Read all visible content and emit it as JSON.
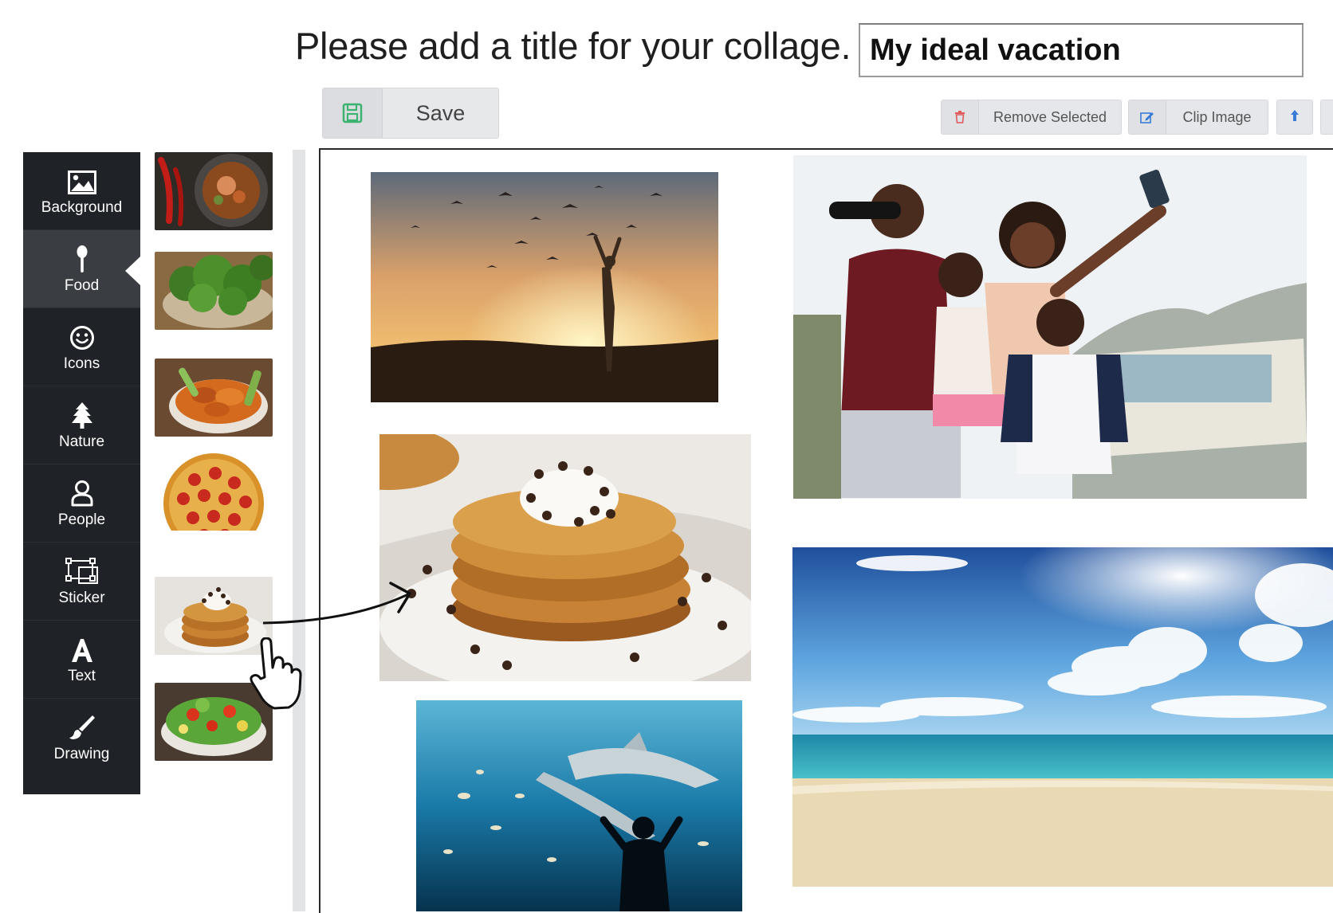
{
  "title_row": {
    "prompt": "Please add a title for your collage.",
    "title_value": "My ideal vacation"
  },
  "toolbar": {
    "save_label": "Save",
    "remove_selected_label": "Remove Selected",
    "clip_image_label": "Clip Image",
    "save_icon": "floppy-disk-icon",
    "remove_icon": "trash-icon",
    "clip_icon": "edit-icon",
    "up_icon": "arrow-up-icon"
  },
  "sidebar": {
    "items": [
      {
        "label": "Background",
        "icon": "image-icon"
      },
      {
        "label": "Food",
        "icon": "spoon-icon"
      },
      {
        "label": "Icons",
        "icon": "smiley-icon"
      },
      {
        "label": "Nature",
        "icon": "tree-icon"
      },
      {
        "label": "People",
        "icon": "person-icon"
      },
      {
        "label": "Sticker",
        "icon": "transform-icon"
      },
      {
        "label": "Text",
        "icon": "letter-a-icon"
      },
      {
        "label": "Drawing",
        "icon": "brush-icon"
      }
    ],
    "active": "Food"
  },
  "thumbnails": [
    "noodles",
    "broccoli",
    "chicken-wings",
    "pizza",
    "pancakes",
    "salad"
  ],
  "collage_photos": [
    "sunset-birds",
    "family-selfie",
    "pancakes",
    "beach",
    "aquarium"
  ],
  "colors": {
    "sidebar_bg": "#1f2226",
    "sidebar_active": "#3a3d42",
    "save_icon": "#3cb371",
    "remove_icon": "#e05a5a",
    "clip_icon": "#3a7bd5"
  }
}
